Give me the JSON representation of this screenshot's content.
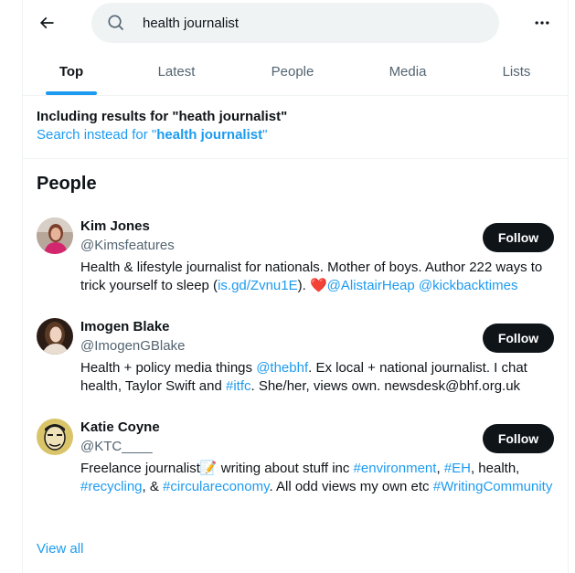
{
  "search": {
    "query": "health journalist"
  },
  "tabs": [
    {
      "label": "Top",
      "active": true
    },
    {
      "label": "Latest",
      "active": false
    },
    {
      "label": "People",
      "active": false
    },
    {
      "label": "Media",
      "active": false
    },
    {
      "label": "Lists",
      "active": false
    }
  ],
  "correction": {
    "including": "Including results for \"heath journalist\"",
    "instead_prefix": "Search instead for \"",
    "instead_term": "health journalist",
    "instead_suffix": "\""
  },
  "people": {
    "heading": "People",
    "follow_label": "Follow",
    "users": [
      {
        "name": "Kim Jones",
        "handle": "@Kimsfeatures",
        "bio": [
          {
            "t": "Health & lifestyle journalist for nationals. Mother of boys. Author 222 ways to trick yourself to sleep (",
            "link": false
          },
          {
            "t": "is.gd/Zvnu1E",
            "link": true
          },
          {
            "t": "). ❤️",
            "link": false
          },
          {
            "t": "@AlistairHeap",
            "link": true
          },
          {
            "t": " ",
            "link": false
          },
          {
            "t": "@kickbacktimes",
            "link": true
          }
        ]
      },
      {
        "name": "Imogen Blake",
        "handle": "@ImogenGBlake",
        "bio": [
          {
            "t": "Health + policy media things ",
            "link": false
          },
          {
            "t": "@thebhf",
            "link": true
          },
          {
            "t": ". Ex local + national journalist. I chat health, Taylor Swift and ",
            "link": false
          },
          {
            "t": "#itfc",
            "link": true
          },
          {
            "t": ". She/her, views own. newsdesk@bhf.org.uk",
            "link": false
          }
        ]
      },
      {
        "name": "Katie Coyne",
        "handle": "@KTC____",
        "bio": [
          {
            "t": "Freelance journalist📝 writing about stuff inc ",
            "link": false
          },
          {
            "t": "#environment",
            "link": true
          },
          {
            "t": ", ",
            "link": false
          },
          {
            "t": "#EH",
            "link": true
          },
          {
            "t": ", health, ",
            "link": false
          },
          {
            "t": "#recycling",
            "link": true
          },
          {
            "t": ", & ",
            "link": false
          },
          {
            "t": "#circulareconomy",
            "link": true
          },
          {
            "t": ". All odd views my own etc ",
            "link": false
          },
          {
            "t": "#WritingCommunity",
            "link": true
          }
        ]
      }
    ]
  },
  "view_all": "View all",
  "colors": {
    "accent": "#1d9bf0",
    "text": "#0f1419",
    "muted": "#536471",
    "search_bg": "#eff3f4"
  }
}
